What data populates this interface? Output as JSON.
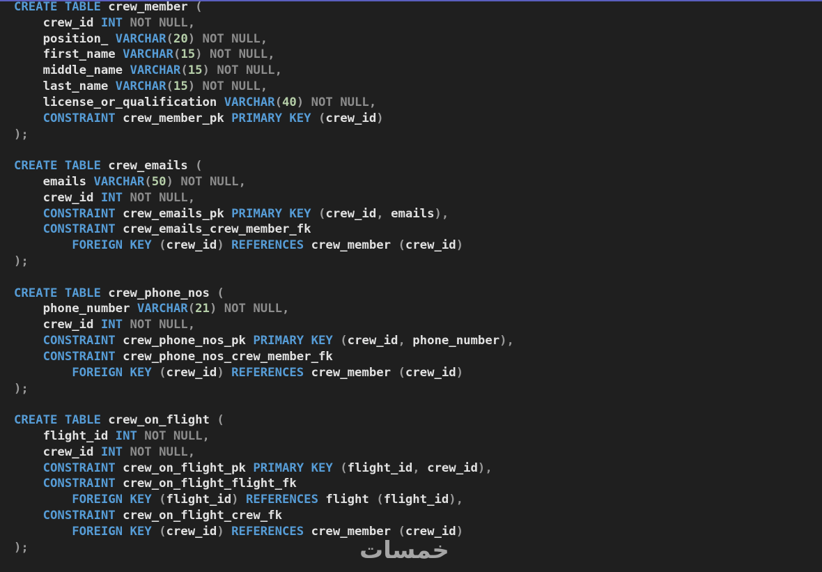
{
  "editor": {
    "language": "sql",
    "colors": {
      "background": "#1f1f1f",
      "keyword": "#569cd6",
      "identifier": "#e2e2e2",
      "number": "#b5cea8",
      "punctuation": "#9a9a9a",
      "not_null": "#8c8c8c"
    },
    "lines": [
      [
        [
          "kw",
          "CREATE TABLE"
        ],
        [
          "ident",
          " crew_member "
        ],
        [
          "punc",
          "("
        ]
      ],
      [
        [
          "ident",
          "    crew_id "
        ],
        [
          "kw",
          "INT"
        ],
        [
          "null",
          " NOT NULL"
        ],
        [
          "punc",
          ","
        ]
      ],
      [
        [
          "ident",
          "    position_ "
        ],
        [
          "kw",
          "VARCHAR"
        ],
        [
          "punc",
          "("
        ],
        [
          "num",
          "20"
        ],
        [
          "punc",
          ")"
        ],
        [
          "null",
          " NOT NULL"
        ],
        [
          "punc",
          ","
        ]
      ],
      [
        [
          "ident",
          "    first_name "
        ],
        [
          "kw",
          "VARCHAR"
        ],
        [
          "punc",
          "("
        ],
        [
          "num",
          "15"
        ],
        [
          "punc",
          ")"
        ],
        [
          "null",
          " NOT NULL"
        ],
        [
          "punc",
          ","
        ]
      ],
      [
        [
          "ident",
          "    middle_name "
        ],
        [
          "kw",
          "VARCHAR"
        ],
        [
          "punc",
          "("
        ],
        [
          "num",
          "15"
        ],
        [
          "punc",
          ")"
        ],
        [
          "null",
          " NOT NULL"
        ],
        [
          "punc",
          ","
        ]
      ],
      [
        [
          "ident",
          "    last_name "
        ],
        [
          "kw",
          "VARCHAR"
        ],
        [
          "punc",
          "("
        ],
        [
          "num",
          "15"
        ],
        [
          "punc",
          ")"
        ],
        [
          "null",
          " NOT NULL"
        ],
        [
          "punc",
          ","
        ]
      ],
      [
        [
          "ident",
          "    license_or_qualification "
        ],
        [
          "kw",
          "VARCHAR"
        ],
        [
          "punc",
          "("
        ],
        [
          "num",
          "40"
        ],
        [
          "punc",
          ")"
        ],
        [
          "null",
          " NOT NULL"
        ],
        [
          "punc",
          ","
        ]
      ],
      [
        [
          "ident",
          "    "
        ],
        [
          "kw",
          "CONSTRAINT"
        ],
        [
          "ident",
          " crew_member_pk "
        ],
        [
          "kw",
          "PRIMARY KEY"
        ],
        [
          "punc",
          " ("
        ],
        [
          "ident",
          "crew_id"
        ],
        [
          "punc",
          ")"
        ]
      ],
      [
        [
          "punc",
          ");"
        ]
      ],
      [],
      [
        [
          "kw",
          "CREATE TABLE"
        ],
        [
          "ident",
          " crew_emails "
        ],
        [
          "punc",
          "("
        ]
      ],
      [
        [
          "ident",
          "    emails "
        ],
        [
          "kw",
          "VARCHAR"
        ],
        [
          "punc",
          "("
        ],
        [
          "num",
          "50"
        ],
        [
          "punc",
          ")"
        ],
        [
          "null",
          " NOT NULL"
        ],
        [
          "punc",
          ","
        ]
      ],
      [
        [
          "ident",
          "    crew_id "
        ],
        [
          "kw",
          "INT"
        ],
        [
          "null",
          " NOT NULL"
        ],
        [
          "punc",
          ","
        ]
      ],
      [
        [
          "ident",
          "    "
        ],
        [
          "kw",
          "CONSTRAINT"
        ],
        [
          "ident",
          " crew_emails_pk "
        ],
        [
          "kw",
          "PRIMARY KEY"
        ],
        [
          "punc",
          " ("
        ],
        [
          "ident",
          "crew_id"
        ],
        [
          "punc",
          ", "
        ],
        [
          "ident",
          "emails"
        ],
        [
          "punc",
          "),"
        ]
      ],
      [
        [
          "ident",
          "    "
        ],
        [
          "kw",
          "CONSTRAINT"
        ],
        [
          "ident",
          " crew_emails_crew_member_fk"
        ]
      ],
      [
        [
          "ident",
          "        "
        ],
        [
          "kw",
          "FOREIGN KEY"
        ],
        [
          "punc",
          " ("
        ],
        [
          "ident",
          "crew_id"
        ],
        [
          "punc",
          ") "
        ],
        [
          "kw",
          "REFERENCES"
        ],
        [
          "ident",
          " crew_member "
        ],
        [
          "punc",
          "("
        ],
        [
          "ident",
          "crew_id"
        ],
        [
          "punc",
          ")"
        ]
      ],
      [
        [
          "punc",
          ");"
        ]
      ],
      [],
      [
        [
          "kw",
          "CREATE TABLE"
        ],
        [
          "ident",
          " crew_phone_nos "
        ],
        [
          "punc",
          "("
        ]
      ],
      [
        [
          "ident",
          "    phone_number "
        ],
        [
          "kw",
          "VARCHAR"
        ],
        [
          "punc",
          "("
        ],
        [
          "num",
          "21"
        ],
        [
          "punc",
          ")"
        ],
        [
          "null",
          " NOT NULL"
        ],
        [
          "punc",
          ","
        ]
      ],
      [
        [
          "ident",
          "    crew_id "
        ],
        [
          "kw",
          "INT"
        ],
        [
          "null",
          " NOT NULL"
        ],
        [
          "punc",
          ","
        ]
      ],
      [
        [
          "ident",
          "    "
        ],
        [
          "kw",
          "CONSTRAINT"
        ],
        [
          "ident",
          " crew_phone_nos_pk "
        ],
        [
          "kw",
          "PRIMARY KEY"
        ],
        [
          "punc",
          " ("
        ],
        [
          "ident",
          "crew_id"
        ],
        [
          "punc",
          ", "
        ],
        [
          "ident",
          "phone_number"
        ],
        [
          "punc",
          "),"
        ]
      ],
      [
        [
          "ident",
          "    "
        ],
        [
          "kw",
          "CONSTRAINT"
        ],
        [
          "ident",
          " crew_phone_nos_crew_member_fk"
        ]
      ],
      [
        [
          "ident",
          "        "
        ],
        [
          "kw",
          "FOREIGN KEY"
        ],
        [
          "punc",
          " ("
        ],
        [
          "ident",
          "crew_id"
        ],
        [
          "punc",
          ") "
        ],
        [
          "kw",
          "REFERENCES"
        ],
        [
          "ident",
          " crew_member "
        ],
        [
          "punc",
          "("
        ],
        [
          "ident",
          "crew_id"
        ],
        [
          "punc",
          ")"
        ]
      ],
      [
        [
          "punc",
          ");"
        ]
      ],
      [],
      [
        [
          "kw",
          "CREATE TABLE"
        ],
        [
          "ident",
          " crew_on_flight "
        ],
        [
          "punc",
          "("
        ]
      ],
      [
        [
          "ident",
          "    flight_id "
        ],
        [
          "kw",
          "INT"
        ],
        [
          "null",
          " NOT NULL"
        ],
        [
          "punc",
          ","
        ]
      ],
      [
        [
          "ident",
          "    crew_id "
        ],
        [
          "kw",
          "INT"
        ],
        [
          "null",
          " NOT NULL"
        ],
        [
          "punc",
          ","
        ]
      ],
      [
        [
          "ident",
          "    "
        ],
        [
          "kw",
          "CONSTRAINT"
        ],
        [
          "ident",
          " crew_on_flight_pk "
        ],
        [
          "kw",
          "PRIMARY KEY"
        ],
        [
          "punc",
          " ("
        ],
        [
          "ident",
          "flight_id"
        ],
        [
          "punc",
          ", "
        ],
        [
          "ident",
          "crew_id"
        ],
        [
          "punc",
          "),"
        ]
      ],
      [
        [
          "ident",
          "    "
        ],
        [
          "kw",
          "CONSTRAINT"
        ],
        [
          "ident",
          " crew_on_flight_flight_fk"
        ]
      ],
      [
        [
          "ident",
          "        "
        ],
        [
          "kw",
          "FOREIGN KEY"
        ],
        [
          "punc",
          " ("
        ],
        [
          "ident",
          "flight_id"
        ],
        [
          "punc",
          ") "
        ],
        [
          "kw",
          "REFERENCES"
        ],
        [
          "ident",
          " flight "
        ],
        [
          "punc",
          "("
        ],
        [
          "ident",
          "flight_id"
        ],
        [
          "punc",
          "),"
        ]
      ],
      [
        [
          "ident",
          "    "
        ],
        [
          "kw",
          "CONSTRAINT"
        ],
        [
          "ident",
          " crew_on_flight_crew_fk"
        ]
      ],
      [
        [
          "ident",
          "        "
        ],
        [
          "kw",
          "FOREIGN KEY"
        ],
        [
          "punc",
          " ("
        ],
        [
          "ident",
          "crew_id"
        ],
        [
          "punc",
          ") "
        ],
        [
          "kw",
          "REFERENCES"
        ],
        [
          "ident",
          " crew_member "
        ],
        [
          "punc",
          "("
        ],
        [
          "ident",
          "crew_id"
        ],
        [
          "punc",
          ")"
        ]
      ],
      [
        [
          "punc",
          ");"
        ]
      ]
    ]
  },
  "watermark": {
    "text": "خمسات"
  }
}
